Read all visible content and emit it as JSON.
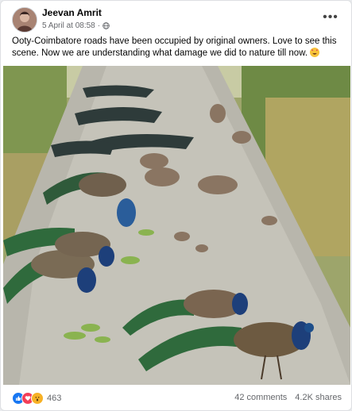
{
  "post": {
    "author": "Jeevan Amrit",
    "timestamp": "5 April at 08:58",
    "privacy_icon": "globe-icon",
    "more_icon": "more-options-icon",
    "more_label": "•••",
    "text": "Ooty-Coimbatore roads have been occupied by original owners. Love to see this scene. Now we are understanding what damage we did to nature till now.",
    "text_emoji": "heart-eyes-emoji"
  },
  "photo": {
    "icon": "peacocks-on-road-photo"
  },
  "footer": {
    "reaction_icons": [
      "like-icon",
      "love-icon",
      "wow-icon"
    ],
    "reaction_count": "463",
    "comments": "42 comments",
    "shares": "4.2K shares"
  },
  "colors": {
    "like": "#1877f2",
    "love": "#f33e58",
    "wow": "#f7b125",
    "meta_text": "#65676b"
  }
}
